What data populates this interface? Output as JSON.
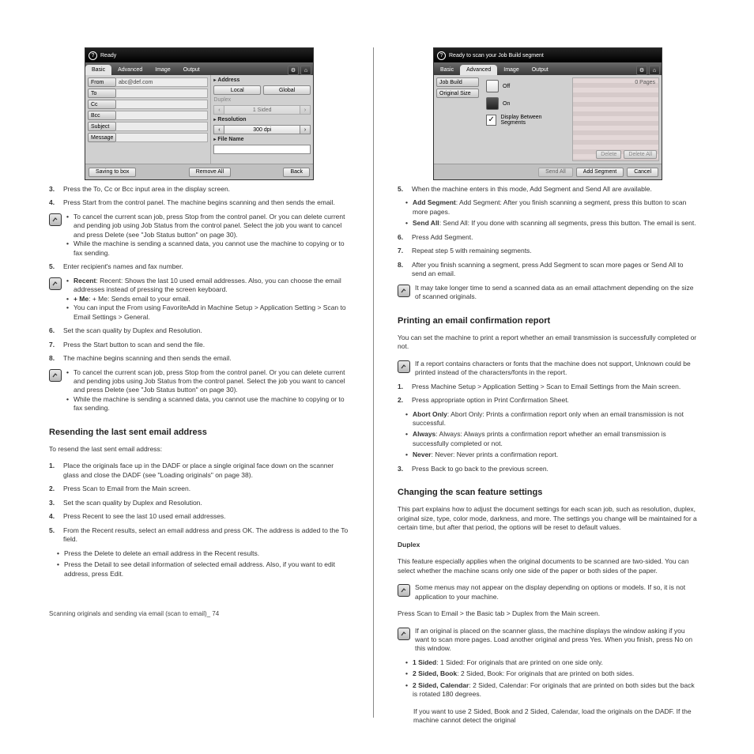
{
  "left": {
    "panel": {
      "title": "Ready",
      "tabs": [
        "Basic",
        "Advanced",
        "Image",
        "Output"
      ],
      "active_tab": "Basic",
      "fields": {
        "from": {
          "label": "From",
          "value": "abc@def.com"
        },
        "to": {
          "label": "To",
          "value": ""
        },
        "cc": {
          "label": "Cc",
          "value": ""
        },
        "bcc": {
          "label": "Bcc",
          "value": ""
        },
        "subject": {
          "label": "Subject",
          "value": ""
        },
        "message": {
          "label": "Message",
          "value": ""
        }
      },
      "address_label": "Address",
      "address_local": "Local",
      "address_global": "Global",
      "duplex_label": "Duplex",
      "duplex_value": "1 Sided",
      "resolution_label": "Resolution",
      "resolution_value": "300 dpi",
      "filename_label": "File Name",
      "footer": {
        "saving": "Saving to box",
        "remove": "Remove All",
        "back": "Back"
      }
    },
    "step3": "Press the To, Cc or Bcc input area in the display screen.",
    "step4_a": "Press Start from the control panel. The machine begins scanning and then sends the email.",
    "note1_a": "To cancel the current scan job, press Stop from the control panel. Or you can delete current and pending job using Job Status from the control panel. Select the job you want to cancel and press Delete (see \"Job Status button\" on page 30).",
    "note1_b": "While the machine is sending a scanned data, you cannot use the machine to copying or to fax sending.",
    "step5": "Enter recipient's names and fax number.",
    "note2_a": "Recent: Shows the last 10 used email addresses. Also, you can choose the email addresses instead of pressing the screen keyboard.",
    "note2_b": "+ Me: Sends email to your email.",
    "note2_c": "You can input the From using FavoriteAdd in Machine Setup > Application Setting > Scan to Email Settings > General.",
    "step6": "Set the scan quality by Duplex and Resolution.",
    "step7": "Press the Start button to scan and send the file.",
    "step8": "The machine begins scanning and then sends the email.",
    "note3_a": "To cancel the current scan job, press Stop from the control panel. Or you can delete current and pending jobs using Job Status from the control panel. Select the job you want to cancel and press Delete (see \"Job Status button\" on page 30).",
    "note3_b": "While the machine is sending a scanned data, you cannot use the machine to copying or to fax sending.",
    "heading": "Resending the last sent email address",
    "resend_intro": "To resend the last sent email address:",
    "resend1": "Place the originals face up in the DADF or place a single original face down on the scanner glass and close the DADF (see \"Loading originals\" on page 38).",
    "resend2": "Press Scan to Email from the Main screen.",
    "resend3": "Set the scan quality by Duplex and Resolution.",
    "resend4": "Press Recent to see the last 10 used email addresses.",
    "resend5": "From the Recent results, select an email address and press OK. The address is added to the To field.",
    "recent_del": "Press the Delete to delete an email address in the Recent results.",
    "recent_detail": "Press the Detail to see detail information of selected email address. Also, if you want to edit address, press Edit.",
    "footnote": "Scanning originals and sending via email (scan to email)_ 74"
  },
  "right": {
    "panel": {
      "title": "Ready to scan your Job Build segment",
      "tabs": [
        "Basic",
        "Advanced",
        "Image",
        "Output"
      ],
      "active_tab": "Advanced",
      "side": {
        "jobbuild": "Job Build",
        "original": "Original Size"
      },
      "opt_off": "Off",
      "opt_on": "On",
      "opt_display": "Display Between Segments",
      "pages": "0 Pages",
      "footer": {
        "sendall": "Send All",
        "addseg": "Add Segment",
        "cancel": "Cancel"
      }
    },
    "step5": "When the machine enters in this mode, Add Segment and Send All are available.",
    "add_seg": "Add Segment: After you finish scanning a segment, press this button to scan more pages.",
    "send_all": "Send All: If you done with scanning all segments, press this button. The email is sent.",
    "step6": "Press Add Segment.",
    "step7": "Repeat step 5 with remaining segments.",
    "step8": "After you finish scanning a segment, press Add Segment to scan more pages or Send All to send an email.",
    "note1": "It may take longer time to send a scanned data as an email attachment depending on the size of scanned originals.",
    "heading1": "Printing an email confirmation report",
    "confirm_intro": "You can set the machine to print a report whether an email transmission is successfully completed or not.",
    "confirm_note": "If a report contains characters or fonts that the machine does not support, Unknown could be printed instead of the characters/fonts in the report.",
    "confirm1": "Press Machine Setup > Application Setting > Scan to Email Settings from the Main screen.",
    "confirm2": "Press appropriate option in Print Confirmation Sheet.",
    "confirm_abort": "Abort Only: Prints a confirmation report only when an email transmission is not successful.",
    "confirm_always": "Always: Always prints a confirmation report whether an email transmission is successfully completed or not.",
    "confirm_never": "Never: Never prints a confirmation report.",
    "confirm3": "Press Back to go back to the previous screen.",
    "heading2": "Changing the scan feature settings",
    "changing_p1": "This part explains how to adjust the document settings for each scan job, such as resolution, duplex, original size, type, color mode, darkness, and more. The settings you change will be maintained for a certain time, but after that period, the options will be reset to default values.",
    "duplex_h": "Duplex",
    "duplex_p": "This feature especially applies when the original documents to be scanned are two-sided. You can select whether the machine scans only one side of the paper or both sides of the paper.",
    "note2": "Some menus may not appear on the display depending on options or models. If so, it is not application to your machine.",
    "dup_path": "Press Scan to Email > the Basic tab > Duplex from the Main screen.",
    "note3": "If an original is placed on the scanner glass, the machine displays the window asking if you want to scan more pages. Load another original and press Yes. When you finish, press No on this window.",
    "dup_1sided": "1 Sided: For originals that are printed on one side only.",
    "dup_2book": "2 Sided, Book: For originals that are printed on both sides.",
    "dup_2cal_a": "2 Sided, Calendar: For originals that are printed on both sides but the back is rotated 180 degrees.",
    "dup_2cal_b": "If you want to use 2 Sided, Book and 2 Sided, Calendar, load the originals on the DADF. If the machine cannot detect the original"
  }
}
